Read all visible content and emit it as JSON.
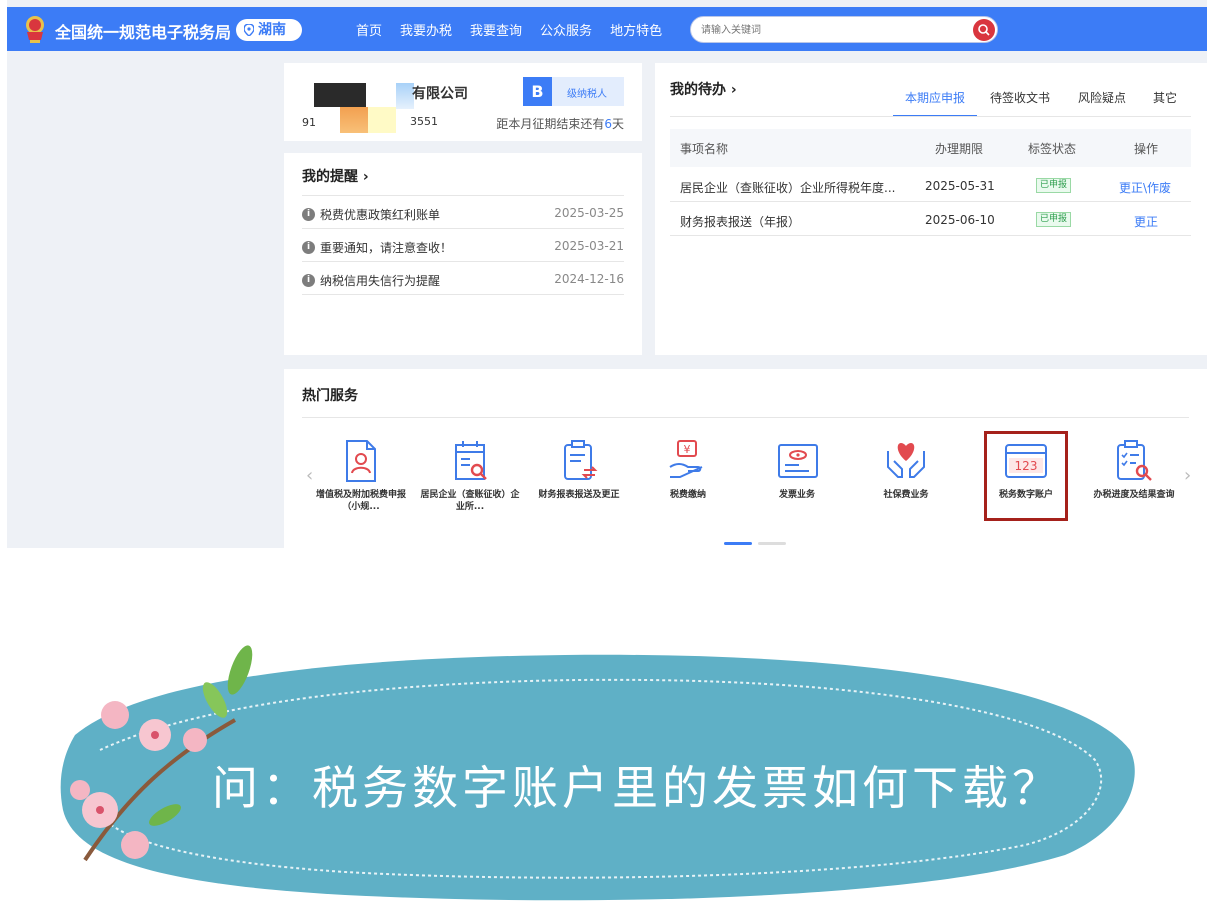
{
  "header": {
    "site_title": "全国统一规范电子税务局",
    "region": "湖南",
    "nav": [
      "首页",
      "我要办税",
      "我要查询",
      "公众服务",
      "地方特色"
    ],
    "search_placeholder": "请输入关键词"
  },
  "company": {
    "name_fragment": "有限公司",
    "id_prefix": "91",
    "id_suffix": "3551",
    "grade_letter": "B",
    "grade_label": "级纳税人",
    "deadline_prefix": "距本月征期结束还有",
    "deadline_days": "6",
    "deadline_suffix": "天"
  },
  "reminders": {
    "title": "我的提醒 ›",
    "items": [
      {
        "text": "税费优惠政策红利账单",
        "date": "2025-03-25"
      },
      {
        "text": "重要通知，请注意查收！",
        "date": "2025-03-21"
      },
      {
        "text": "纳税信用失信行为提醒",
        "date": "2024-12-16"
      }
    ]
  },
  "todo": {
    "title": "我的待办 ›",
    "tabs": [
      "本期应申报",
      "待签收文书",
      "风险疑点",
      "其它"
    ],
    "columns": [
      "事项名称",
      "办理期限",
      "标签状态",
      "操作"
    ],
    "rows": [
      {
        "name": "居民企业（查账征收）企业所得税年度...",
        "deadline": "2025-05-31",
        "status": "已申报",
        "op": "更正\\作废"
      },
      {
        "name": "财务报表报送（年报）",
        "deadline": "2025-06-10",
        "status": "已申报",
        "op": "更正"
      }
    ]
  },
  "hot_services": {
    "title": "热门服务",
    "items": [
      {
        "label": "增值税及附加税费申报（小规...",
        "icon": "document-person-icon"
      },
      {
        "label": "居民企业（查账征收）企业所...",
        "icon": "calendar-search-icon"
      },
      {
        "label": "财务报表报送及更正",
        "icon": "report-exchange-icon"
      },
      {
        "label": "税费缴纳",
        "icon": "hand-yuan-icon"
      },
      {
        "label": "发票业务",
        "icon": "invoice-icon"
      },
      {
        "label": "社保费业务",
        "icon": "hands-heart-icon"
      },
      {
        "label": "税务数字账户",
        "icon": "digital-account-icon",
        "highlighted": true
      },
      {
        "label": "办税进度及结果查询",
        "icon": "checklist-search-icon"
      }
    ],
    "carousel_page": 1,
    "carousel_pages": 2
  },
  "banner": {
    "question": "问：税务数字账户里的发票如何下载？"
  },
  "colors": {
    "brand_blue": "#3c7cf6",
    "icon_blue": "#3f7be8",
    "icon_red": "#e24a4f",
    "highlight_border": "#a5211b",
    "banner_teal": "#5fb0c6"
  }
}
